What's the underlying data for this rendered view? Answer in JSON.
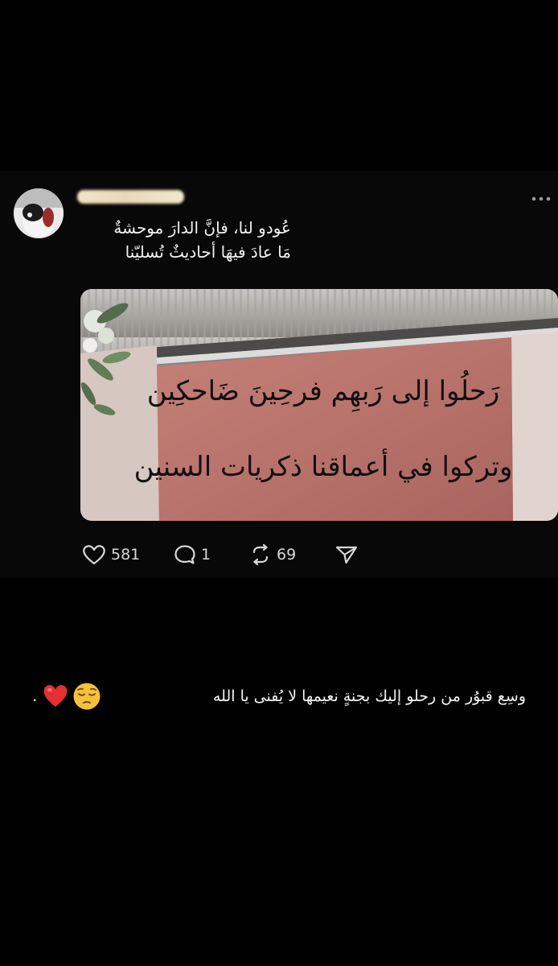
{
  "post": {
    "lines": [
      "عُودو لنا، فإنَّ الدارَ موحشةٌ",
      "مَا عادَ فيهَا أحاديثٌ تُسليّنا"
    ],
    "image": {
      "inscription_lines": [
        "رَحلُوا إلى رَبهِم فرحِينَ ضَاحكِين",
        "وتركوا في أعماقنا ذكريات السنين"
      ]
    },
    "actions": {
      "likes": "581",
      "replies": "1",
      "reposts": "69"
    },
    "icons": [
      "heart-icon",
      "reply-icon",
      "repost-icon",
      "share-icon",
      "more-icon"
    ]
  },
  "caption": {
    "text": "وسِع قبوُر من رحلو إليك بجنةٍ نعيمها لا يُفنى يا الله",
    "emojis": [
      "pensive-face",
      "red-heart"
    ],
    "trailing": "."
  },
  "colors": {
    "background": "#000000",
    "card": "#080809",
    "text": "#f2f2f2",
    "muted": "#d8d8d8",
    "wall": "#b8736c"
  }
}
